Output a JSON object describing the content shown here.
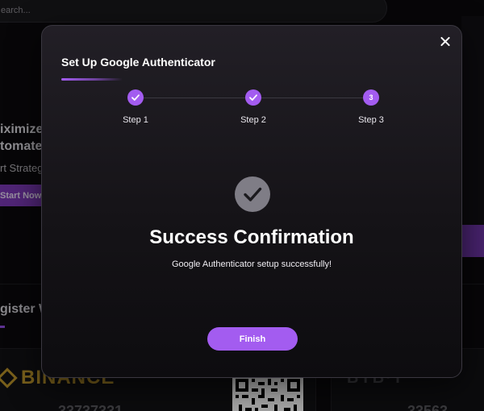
{
  "background": {
    "search_placeholder": "earch...",
    "hero_line1": "iximize",
    "hero_line2": "tomate",
    "hero_sub": "rt Strateg",
    "start_button": "Start Now",
    "register_heading": "gister W",
    "exchange_left": "BINANCE",
    "exchange_right": "BYB·T",
    "number_left": "33737331",
    "number_right": "33563"
  },
  "modal": {
    "title": "Set Up Google Authenticator",
    "steps": [
      {
        "label": "Step 1",
        "state": "completed",
        "icon": "check-icon"
      },
      {
        "label": "Step 2",
        "state": "completed",
        "icon": "check-icon"
      },
      {
        "label": "Step 3",
        "state": "current",
        "number": "3"
      }
    ],
    "success_icon": "check-circle-icon",
    "success_title": "Success Confirmation",
    "success_message": "Google Authenticator setup successfully!",
    "finish_button": "Finish"
  },
  "colors": {
    "accent": "#a35cf0",
    "modal_bg": "#151317",
    "success_icon_bg": "#7f7d86"
  }
}
